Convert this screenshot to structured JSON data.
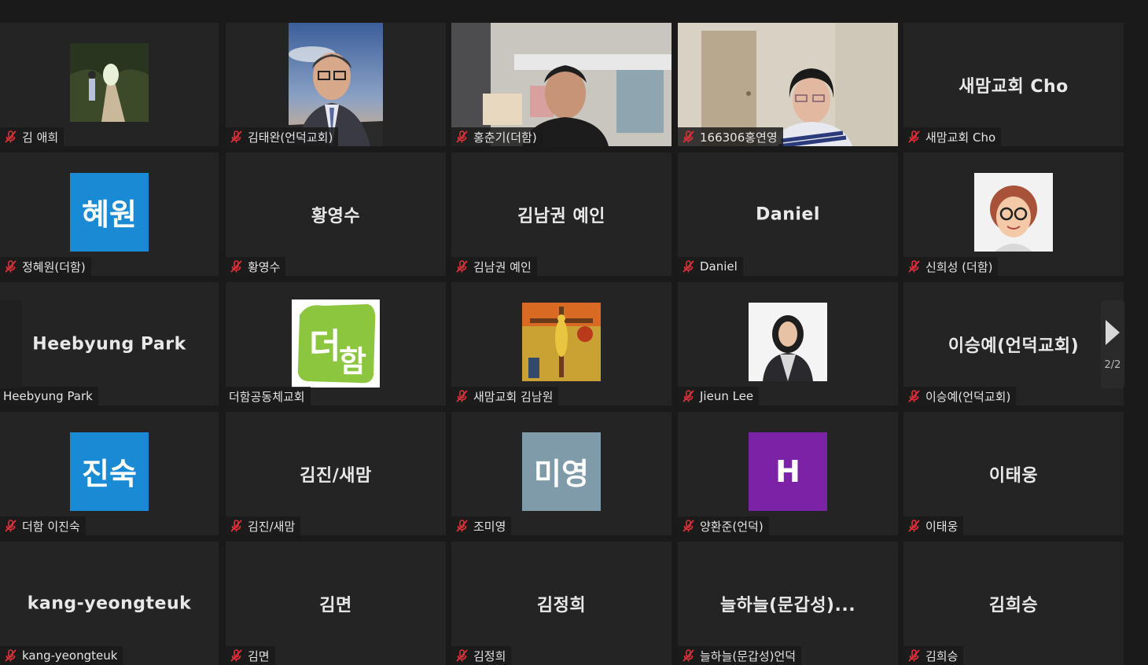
{
  "pager": {
    "page_indicator": "2/2"
  },
  "tiles": [
    {
      "label": "김 애희",
      "type": "photo",
      "photo": "forest-path",
      "muted": true
    },
    {
      "label": "김태완(언덕교회)",
      "type": "video",
      "scene": "man-sky",
      "muted": true
    },
    {
      "label": "홍춘기(더함)",
      "type": "video",
      "scene": "man-room",
      "muted": true
    },
    {
      "label": "166306홍연영",
      "type": "video",
      "scene": "woman-door",
      "muted": true
    },
    {
      "label": "새맘교회 Cho",
      "type": "name",
      "display": "새맘교회 Cho",
      "muted": true
    },
    {
      "label": "정혜원(더함)",
      "type": "avatar",
      "initials": "혜원",
      "color": "#1a8ad4",
      "muted": true
    },
    {
      "label": "황영수",
      "type": "name",
      "display": "황영수",
      "muted": true
    },
    {
      "label": "김남권 예인",
      "type": "name",
      "display": "김남권 예인",
      "muted": true
    },
    {
      "label": "Daniel",
      "type": "name",
      "display": "Daniel",
      "muted": true
    },
    {
      "label": "신희성 (더함)",
      "type": "photo",
      "photo": "cartoon-face",
      "muted": true
    },
    {
      "label": "Heebyung Park",
      "type": "name",
      "display": "Heebyung Park",
      "muted": false
    },
    {
      "label": "더함공동체교회",
      "type": "photo",
      "photo": "green-logo",
      "muted": false
    },
    {
      "label": "새맘교회 김남원",
      "type": "photo",
      "photo": "yellow-christ-painting",
      "muted": true
    },
    {
      "label": "Jieun Lee",
      "type": "photo",
      "photo": "woman-portrait",
      "muted": true
    },
    {
      "label": "이승예(언덕교회)",
      "type": "name",
      "display": "이승예(언덕교회)",
      "muted": true
    },
    {
      "label": "더함 이진숙",
      "type": "avatar",
      "initials": "진숙",
      "color": "#1a8ad4",
      "muted": true
    },
    {
      "label": "김진/새맘",
      "type": "name",
      "display": "김진/새맘",
      "muted": true
    },
    {
      "label": "조미영",
      "type": "avatar",
      "initials": "미영",
      "color": "#7f9aa8",
      "muted": true
    },
    {
      "label": "양환준(언덕)",
      "type": "avatar",
      "initials": "H",
      "color": "#7b22a6",
      "muted": true
    },
    {
      "label": "이태웅",
      "type": "name",
      "display": "이태웅",
      "muted": true
    },
    {
      "label": "kang-yeongteuk",
      "type": "name",
      "display": "kang-yeongteuk",
      "muted": true
    },
    {
      "label": "김면",
      "type": "name",
      "display": "김면",
      "muted": true
    },
    {
      "label": "김정희",
      "type": "name",
      "display": "김정희",
      "muted": true
    },
    {
      "label": "늘하늘(문갑성)언덕",
      "type": "name",
      "display": "늘하늘(문갑성)...",
      "muted": true
    },
    {
      "label": "김희승",
      "type": "name",
      "display": "김희승",
      "muted": true
    }
  ],
  "icons": {
    "muted": "mic-off-icon",
    "next": "chevron-right-icon"
  },
  "colors": {
    "mute_red": "#e0303a",
    "tile_bg": "#242424",
    "page_bg": "#1a1a1a"
  }
}
